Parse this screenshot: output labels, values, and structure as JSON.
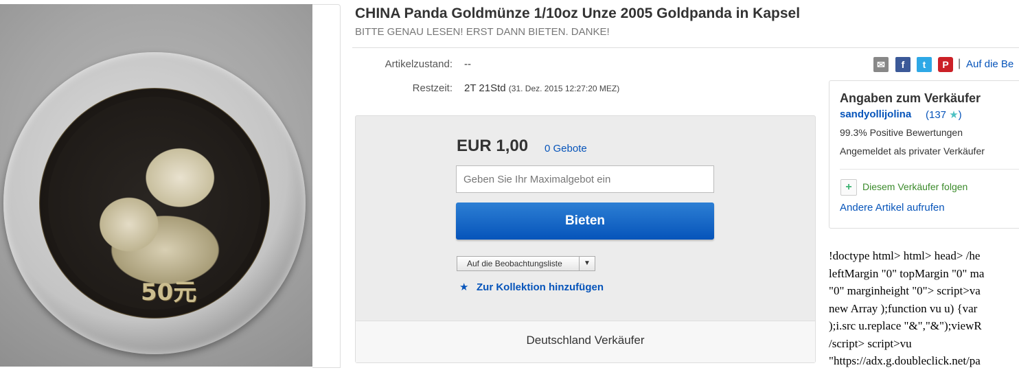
{
  "listing": {
    "title": "CHINA Panda Goldmünze 1/10oz Unze 2005 Goldpanda in Kapsel",
    "subtitle": "BITTE GENAU LESEN! ERST DANN BIETEN. DANKE!",
    "condition_label": "Artikelzustand:",
    "condition_value": "--",
    "time_label": "Restzeit:",
    "time_value": "2T 21Std",
    "time_detail": "(31. Dez. 2015   12:27:20 MEZ)"
  },
  "image": {
    "coin_text": "50元"
  },
  "bid": {
    "price": "EUR 1,00",
    "bids_count": "0 Gebote",
    "max_bid_placeholder": "Geben Sie Ihr Maximalgebot ein",
    "bid_button": "Bieten",
    "watchlist_button": "Auf die Beobachtungsliste",
    "collection_link": "Zur Kollektion hinzufügen",
    "seller_country": "Deutschland Verkäufer"
  },
  "share": {
    "separator": "|",
    "watch_link": "Auf die Be"
  },
  "seller": {
    "heading": "Angaben zum Verkäufer",
    "name": "sandyollijolina",
    "score_open": "(137",
    "score_close": ")",
    "positive": "99.3% Positive Bewertungen",
    "private": "Angemeldet als privater Verkäufer",
    "follow": "Diesem Verkäufer folgen",
    "other_items": "Andere Artikel aufrufen"
  },
  "raw_html_lines": [
    "!doctype html> html> head> /he",
    "leftMargin \"0\" topMargin \"0\" ma",
    "\"0\" marginheight \"0\"> script>va",
    "new Array );function vu u) {var",
    ");i.src u.replace \"&\",\"&\");viewR",
    "/script> script>vu",
    "\"https://adx.g.doubleclick.net/pa"
  ],
  "colors": {
    "link": "#0654ba",
    "bid_button": "#0654ba",
    "star": "#4dc1c3"
  }
}
